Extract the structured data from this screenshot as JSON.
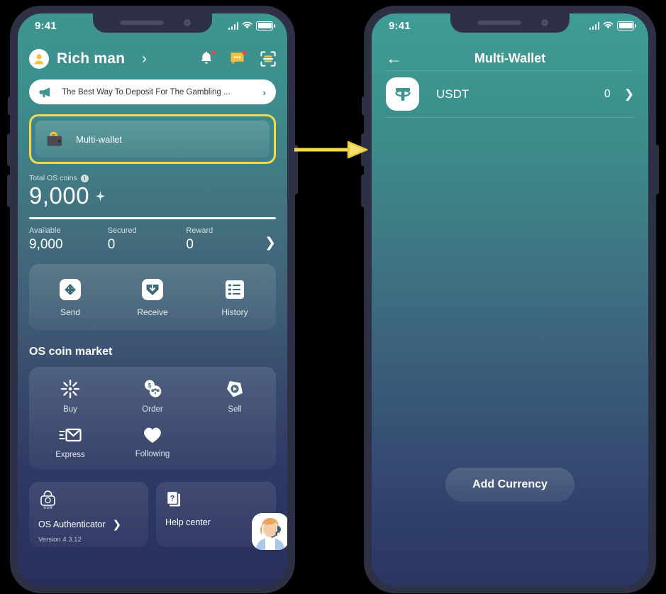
{
  "colors": {
    "highlight": "#f2d94e",
    "arrow": "#f2d94e",
    "accent_teal": "#3e9591",
    "badge_red": "#ec4a42",
    "avatar_yellow": "#f5c13b"
  },
  "phone_left": {
    "status_bar": {
      "time": "9:41",
      "signal_icon": "signal-bars-icon",
      "wifi_icon": "wifi-icon",
      "battery_icon": "battery-icon"
    },
    "header": {
      "avatar_icon": "user-avatar-icon",
      "username": "Rich man",
      "chevron": "›",
      "bell_icon": "bell-icon",
      "message_icon": "message-icon",
      "scan_icon": "scan-qr-icon"
    },
    "notice": {
      "megaphone_icon": "megaphone-icon",
      "text": "The Best Way To Deposit For The Gambling ...",
      "chevron": "›"
    },
    "multi_wallet": {
      "icon": "wallet-coin-icon",
      "label": "Multi-wallet"
    },
    "balance": {
      "label": "Total OS coins",
      "info_icon": "info-icon",
      "amount": "9,000",
      "sparkle_icon": "sparkle-icon"
    },
    "stats": [
      {
        "key": "Available",
        "value": "9,000"
      },
      {
        "key": "Secured",
        "value": "0"
      },
      {
        "key": "Reward",
        "value": "0"
      }
    ],
    "stats_chevron": "❯",
    "actions": [
      {
        "icon": "send-icon",
        "label": "Send"
      },
      {
        "icon": "receive-icon",
        "label": "Receive"
      },
      {
        "icon": "history-icon",
        "label": "History"
      }
    ],
    "market": {
      "title": "OS coin market",
      "row1": [
        {
          "icon": "buy-burst-icon",
          "label": "Buy"
        },
        {
          "icon": "order-coins-icon",
          "label": "Order"
        },
        {
          "icon": "sell-tag-icon",
          "label": "Sell"
        }
      ],
      "row2": [
        {
          "icon": "express-envelope-icon",
          "label": "Express"
        },
        {
          "icon": "heart-icon",
          "label": "Following"
        }
      ]
    },
    "bottom": {
      "authenticator": {
        "icon": "authenticator-icon",
        "label": "OS Authenticator",
        "chevron": "❯",
        "version": "Version 4.3.12"
      },
      "help": {
        "icon": "question-doc-icon",
        "label": "Help center",
        "agent_icon": "support-agent-avatar-icon"
      }
    }
  },
  "phone_right": {
    "status_bar": {
      "time": "9:41",
      "signal_icon": "signal-bars-icon",
      "wifi_icon": "wifi-icon",
      "battery_icon": "battery-icon"
    },
    "navbar": {
      "back_icon": "back-arrow-icon",
      "title": "Multi-Wallet"
    },
    "coins": [
      {
        "icon": "usdt-tether-icon",
        "name": "USDT",
        "amount": "0",
        "chevron": "❯"
      }
    ],
    "add_currency_label": "Add Currency"
  },
  "connector": {
    "arrow_icon": "flow-arrow-right-icon"
  }
}
